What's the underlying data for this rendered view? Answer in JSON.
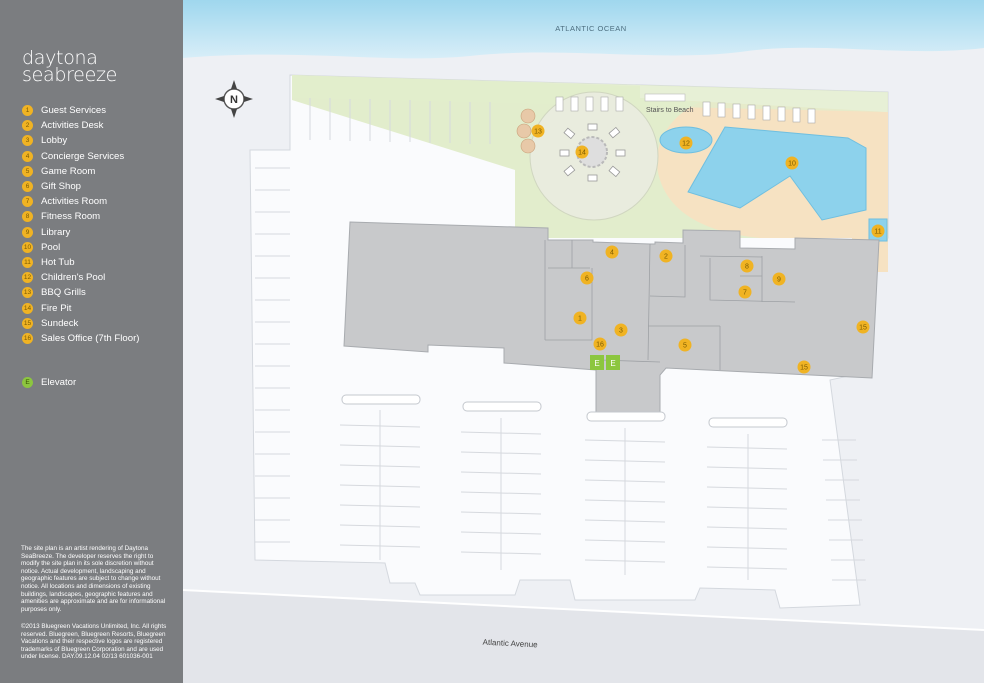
{
  "brand": {
    "line1": "daytona",
    "line2": "seabreeze"
  },
  "legend": [
    {
      "num": "1",
      "label": "Guest Services"
    },
    {
      "num": "2",
      "label": "Activities Desk"
    },
    {
      "num": "3",
      "label": "Lobby"
    },
    {
      "num": "4",
      "label": "Concierge Services"
    },
    {
      "num": "5",
      "label": "Game Room"
    },
    {
      "num": "6",
      "label": "Gift Shop"
    },
    {
      "num": "7",
      "label": "Activities Room"
    },
    {
      "num": "8",
      "label": "Fitness Room"
    },
    {
      "num": "9",
      "label": "Library"
    },
    {
      "num": "10",
      "label": "Pool"
    },
    {
      "num": "11",
      "label": "Hot Tub"
    },
    {
      "num": "12",
      "label": "Children's Pool"
    },
    {
      "num": "13",
      "label": "BBQ Grills"
    },
    {
      "num": "14",
      "label": "Fire Pit"
    },
    {
      "num": "15",
      "label": "Sundeck"
    },
    {
      "num": "16",
      "label": "Sales Office (7th Floor)"
    }
  ],
  "elevator": {
    "symbol": "E",
    "label": "Elevator"
  },
  "disclaimer": "The site plan is an artist rendering of Daytona SeaBreeze. The developer reserves the right to modify the site plan in its sole discretion without notice. Actual development, landscaping and geographic features are subject to change without notice. All locations and dimensions of existing buildings, landscapes, geographic features and amenities are approximate and are for informational purposes only.",
  "copyright": "©2013 Bluegreen Vacations Unlimited, Inc. All rights reserved. Bluegreen, Bluegreen Resorts, Bluegreen Vacations and their respective logos are registered trademarks of Bluegreen Corporation and are used under license.   DAY.09.12.04  02/13  601036-001",
  "map": {
    "ocean_label": "ATLANTIC OCEAN",
    "street_label": "Atlantic Avenue",
    "stairs_label": "Stairs to Beach",
    "compass": "N",
    "markers": [
      "1",
      "2",
      "3",
      "4",
      "5",
      "6",
      "7",
      "8",
      "9",
      "10",
      "11",
      "12",
      "13",
      "14",
      "15",
      "15",
      "16"
    ],
    "elevators": [
      "E",
      "E"
    ]
  },
  "colors": {
    "sidebar": "#7b7d80",
    "marker": "#f0b323",
    "elevator": "#8cc63f",
    "building": "#c8c9cb",
    "lawn": "#e2edcc",
    "sand": "#f6e2c2",
    "pool": "#8dd2ec",
    "ocean": "#aadcf0"
  }
}
